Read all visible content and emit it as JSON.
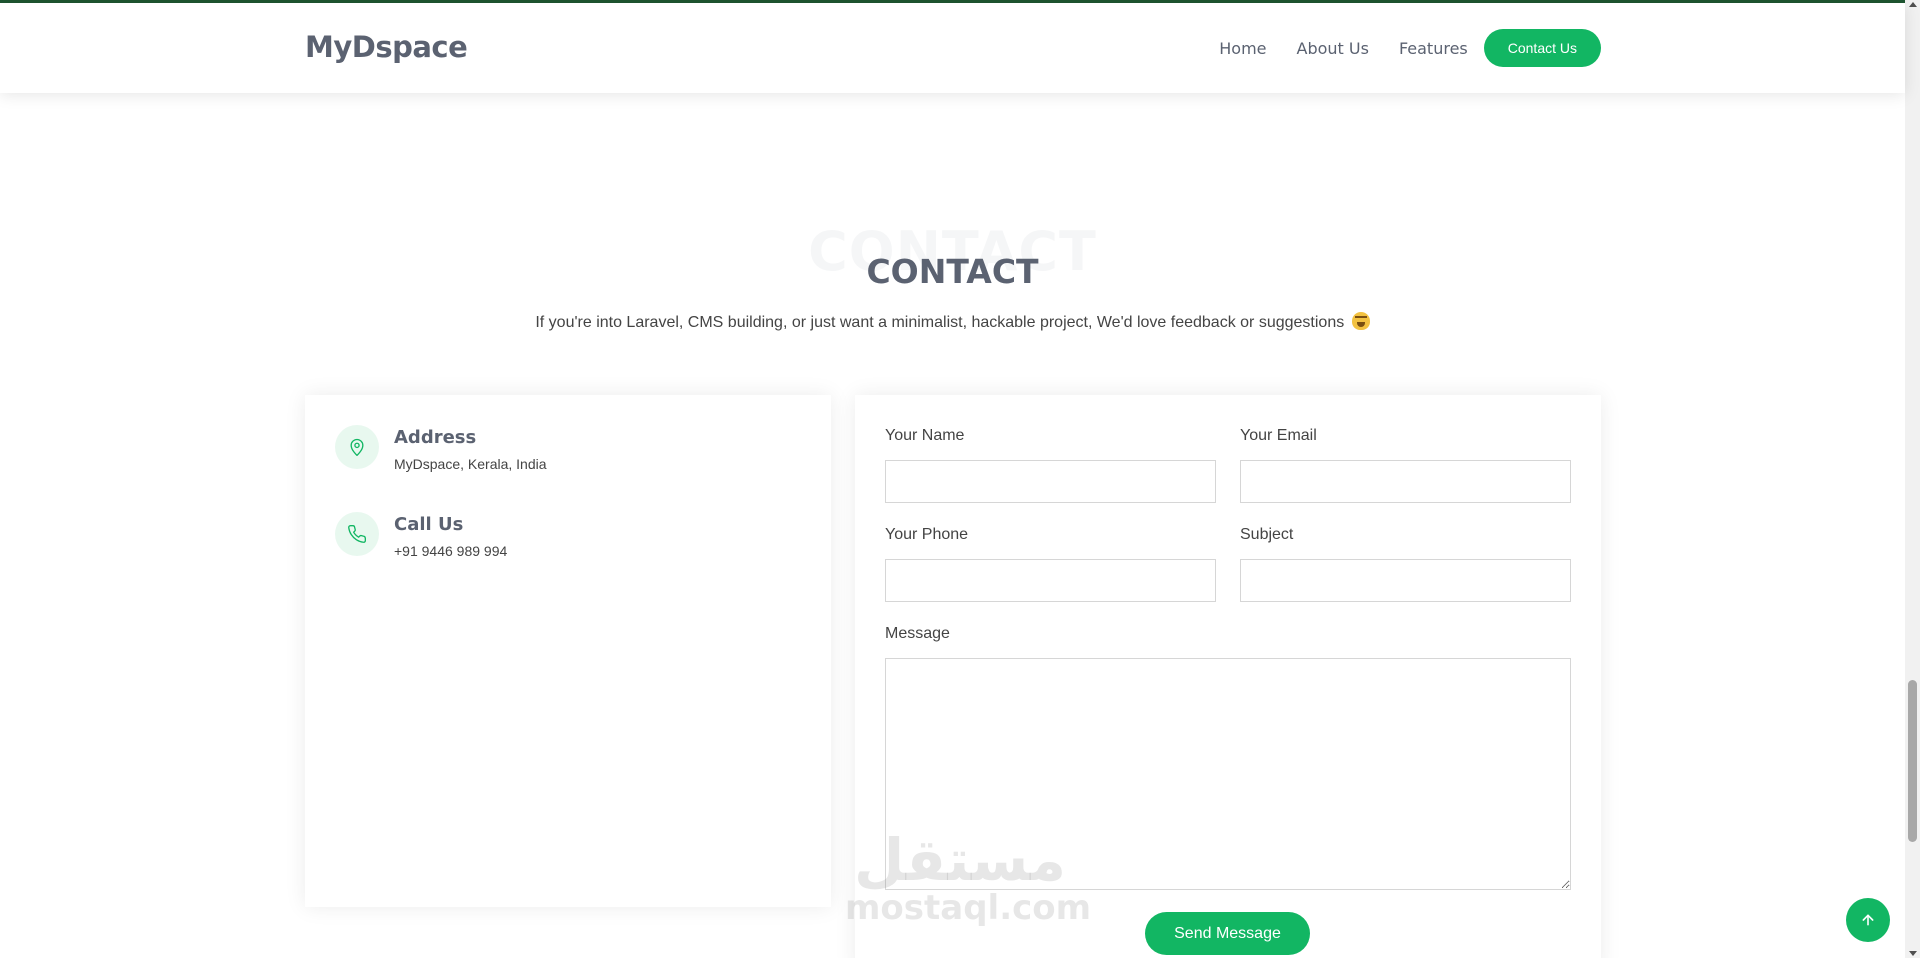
{
  "header": {
    "logo": "MyDspace",
    "nav": [
      {
        "label": "Home"
      },
      {
        "label": "About Us"
      },
      {
        "label": "Features"
      }
    ],
    "cta_label": "Contact Us"
  },
  "section": {
    "title_bg": "CONTACT",
    "title": "CONTACT",
    "subtitle": "If you're into Laravel, CMS building, or just want a minimalist, hackable project, We'd love feedback or suggestions"
  },
  "info": {
    "address": {
      "title": "Address",
      "value": "MyDspace, Kerala, India",
      "icon": "map-pin-icon"
    },
    "call": {
      "title": "Call Us",
      "value": "+91 9446 989 994",
      "icon": "phone-icon"
    }
  },
  "form": {
    "name_label": "Your Name",
    "email_label": "Your Email",
    "phone_label": "Your Phone",
    "subject_label": "Subject",
    "message_label": "Message",
    "name_value": "",
    "email_value": "",
    "phone_value": "",
    "subject_value": "",
    "message_value": "",
    "send_label": "Send Message"
  },
  "watermark": {
    "arabic": "مستقل",
    "latin": "mostaql.com"
  },
  "colors": {
    "accent": "#12b663",
    "heading": "#5b6271",
    "topline": "#1e5631"
  }
}
